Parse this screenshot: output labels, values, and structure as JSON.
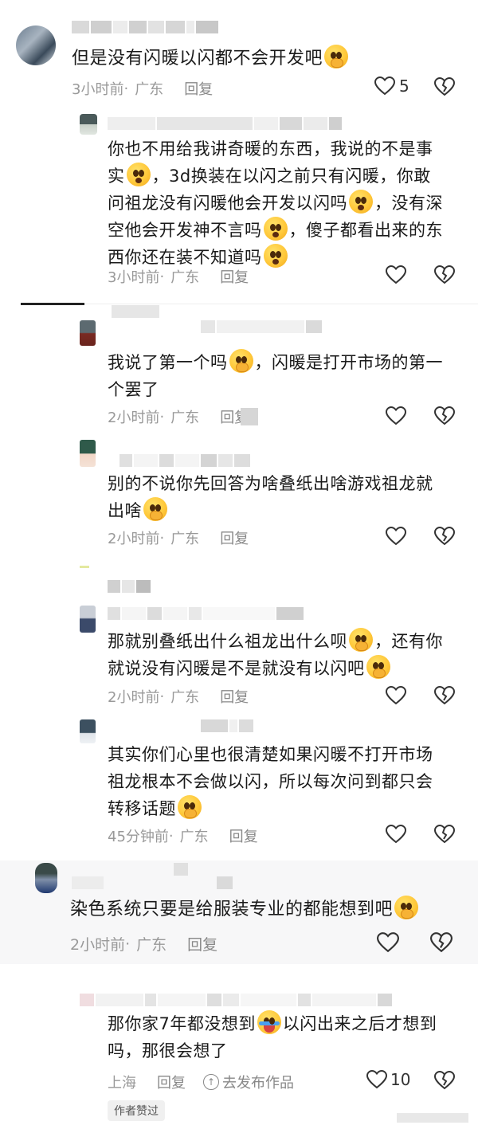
{
  "comments": [
    {
      "text_parts": [
        "但是没有闪暖以闪都不会开发吧"
      ],
      "emoji_after": [
        "shy-face"
      ],
      "time": "3小时前",
      "location": "广东",
      "reply_label": "回复",
      "likes": "5"
    },
    {
      "text_parts": [
        "你也不用给我讲奇暖的东西，我说的不是事",
        "实",
        "，3d换装在以闪之前只有闪暖，你敢",
        "问祖龙没有闪暖他会开发以闪吗",
        "，没有深",
        "空他会开发神不言吗",
        "，傻子都看出来的东",
        "西你还在装不知道吗"
      ],
      "time": "3小时前",
      "location": "广东",
      "reply_label": "回复"
    },
    {
      "text_parts": [
        "我说了第一个吗",
        "，闪暖是打开市场的第一",
        "个罢了"
      ],
      "time": "2小时前",
      "location": "广东",
      "reply_label": "回复"
    },
    {
      "text_parts": [
        "别的不说你先回答为啥叠纸出啥游戏祖龙就",
        "出啥"
      ],
      "time": "2小时前",
      "location": "广东",
      "reply_label": "回复"
    },
    {
      "text_parts": [
        "那就别叠纸出什么祖龙出什么呗",
        "，还有你",
        "就说没有闪暖是不是就没有以闪吧"
      ],
      "time": "2小时前",
      "location": "广东",
      "reply_label": "回复"
    },
    {
      "text_parts": [
        "其实你们心里也很清楚如果闪暖不打开市场",
        "祖龙根本不会做以闪，所以每次问到都只会",
        "转移话题"
      ],
      "time": "45分钟前",
      "location": "广东",
      "reply_label": "回复"
    },
    {
      "text_parts": [
        "染色系统只要是给服装专业的都能想到吧"
      ],
      "time": "2小时前",
      "location": "广东",
      "reply_label": "回复"
    },
    {
      "text_parts": [
        "那你家7年都没想到",
        "以闪出来之后才想到",
        "吗，那很会想了"
      ],
      "location": "上海",
      "reply_label": "回复",
      "publish_label": "去发布作品",
      "likes": "10",
      "badge": "作者赞过"
    }
  ],
  "icons": {
    "like": "heart-outline-icon",
    "dislike": "broken-heart-icon",
    "publish": "arrow-up-circle-icon",
    "emoji_shy": "shy-face-emoji",
    "emoji_cry": "crying-laughing-emoji"
  },
  "colors": {
    "text": "#1a1a1a",
    "meta": "#999999",
    "background": "#ffffff"
  }
}
